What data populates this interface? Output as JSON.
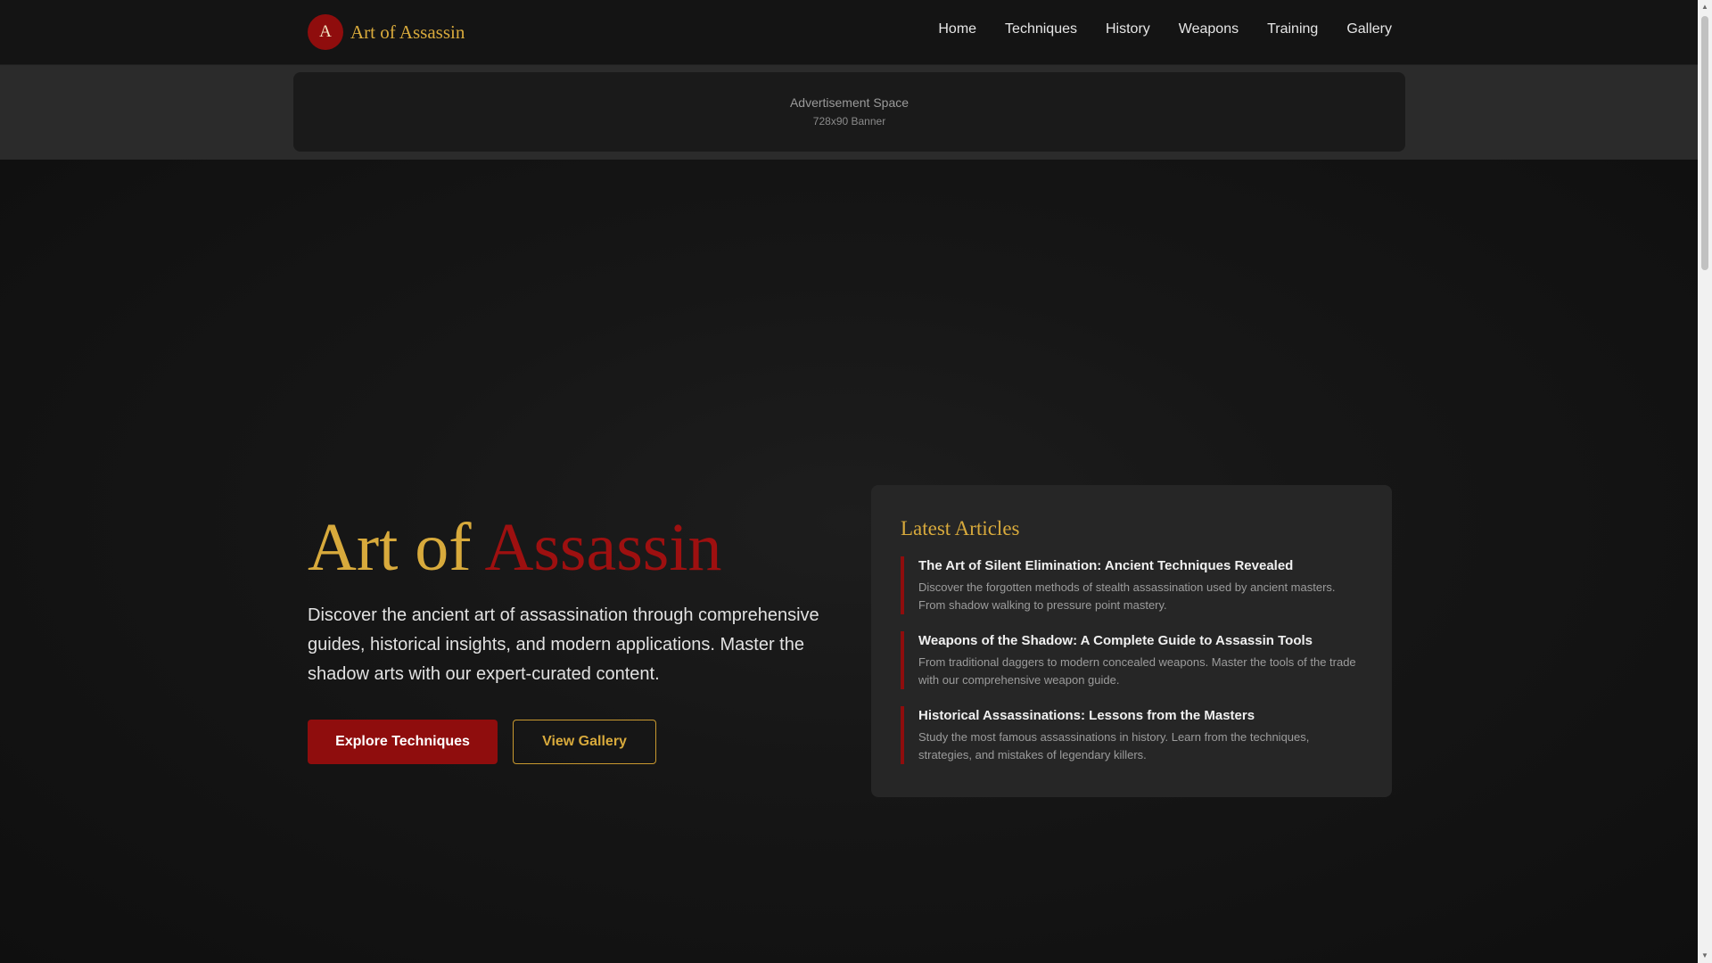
{
  "site": {
    "logo_letter": "A",
    "logo_text": "Art of Assassin"
  },
  "nav": {
    "items": [
      "Home",
      "Techniques",
      "History",
      "Weapons",
      "Training",
      "Gallery"
    ]
  },
  "ad": {
    "title": "Advertisement Space",
    "subtitle": "728x90 Banner"
  },
  "hero": {
    "title_part1": "Art of",
    "title_part2": "Assassin",
    "description": "Discover the ancient art of assassination through comprehensive guides, historical insights, and modern applications. Master the shadow arts with our expert-curated content.",
    "primary_button": "Explore Techniques",
    "secondary_button": "View Gallery"
  },
  "articles": {
    "heading": "Latest Articles",
    "items": [
      {
        "title": "The Art of Silent Elimination: Ancient Techniques Revealed",
        "description": "Discover the forgotten methods of stealth assassination used by ancient masters. From shadow walking to pressure point mastery."
      },
      {
        "title": "Weapons of the Shadow: A Complete Guide to Assassin Tools",
        "description": "From traditional daggers to modern concealed weapons. Master the tools of the trade with our comprehensive weapon guide."
      },
      {
        "title": "Historical Assassinations: Lessons from the Masters",
        "description": "Study the most famous assassinations in history. Learn from the techniques, strategies, and mistakes of legendary killers."
      }
    ]
  },
  "colors": {
    "gold": "#d8aa3c",
    "crimson": "#8f0d0d",
    "background": "#121212",
    "panel": "#262626"
  },
  "icons": {
    "scroll_up": "scroll-up-arrow-icon",
    "scroll_down": "scroll-down-arrow-icon"
  }
}
